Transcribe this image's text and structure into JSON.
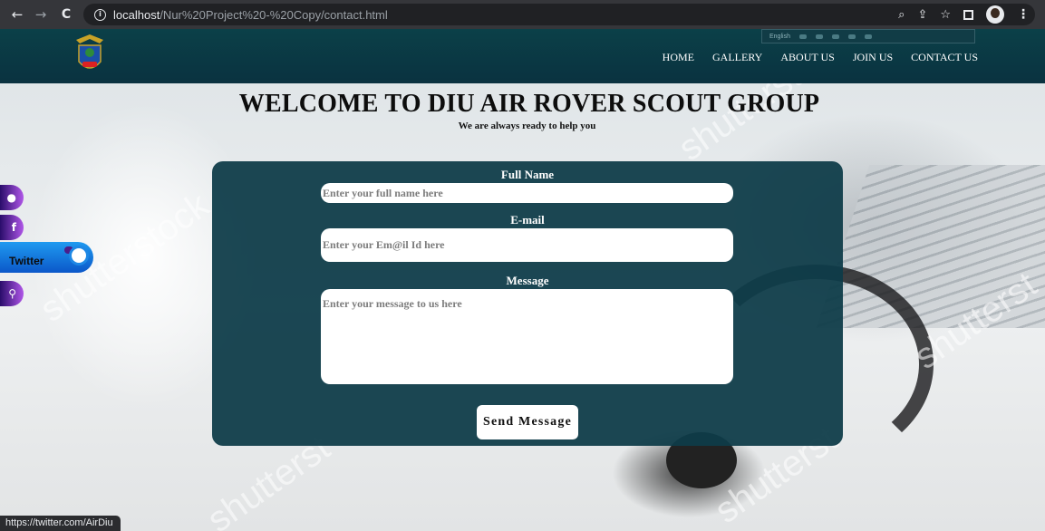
{
  "browser": {
    "url_host": "localhost",
    "url_path": "/Nur%20Project%20-%20Copy/contact.html",
    "status_link": "https://twitter.com/AirDiu"
  },
  "site": {
    "language_label": "English",
    "nav": [
      "HOME",
      "GALLERY",
      "ABOUT US",
      "JOIN US",
      "CONTACT US"
    ]
  },
  "hero": {
    "title": "WELCOME TO DIU AIR ROVER SCOUT GROUP",
    "subtitle": "We are always ready to help you"
  },
  "social": {
    "twitter_label": "Twitter",
    "facebook_glyph": "f"
  },
  "form": {
    "full_name_label": "Full Name",
    "full_name_placeholder": "Enter your full name here",
    "email_label": "E-mail",
    "email_placeholder": "Enter your Em@il Id here",
    "message_label": "Message",
    "message_placeholder": "Enter your message to us here",
    "submit_label": "Send Message"
  },
  "colors": {
    "header_bg": "#0a3240",
    "card_bg": "#0e3c48",
    "twitter_blue": "#1f9af0",
    "side_purple": "#b056e8"
  }
}
